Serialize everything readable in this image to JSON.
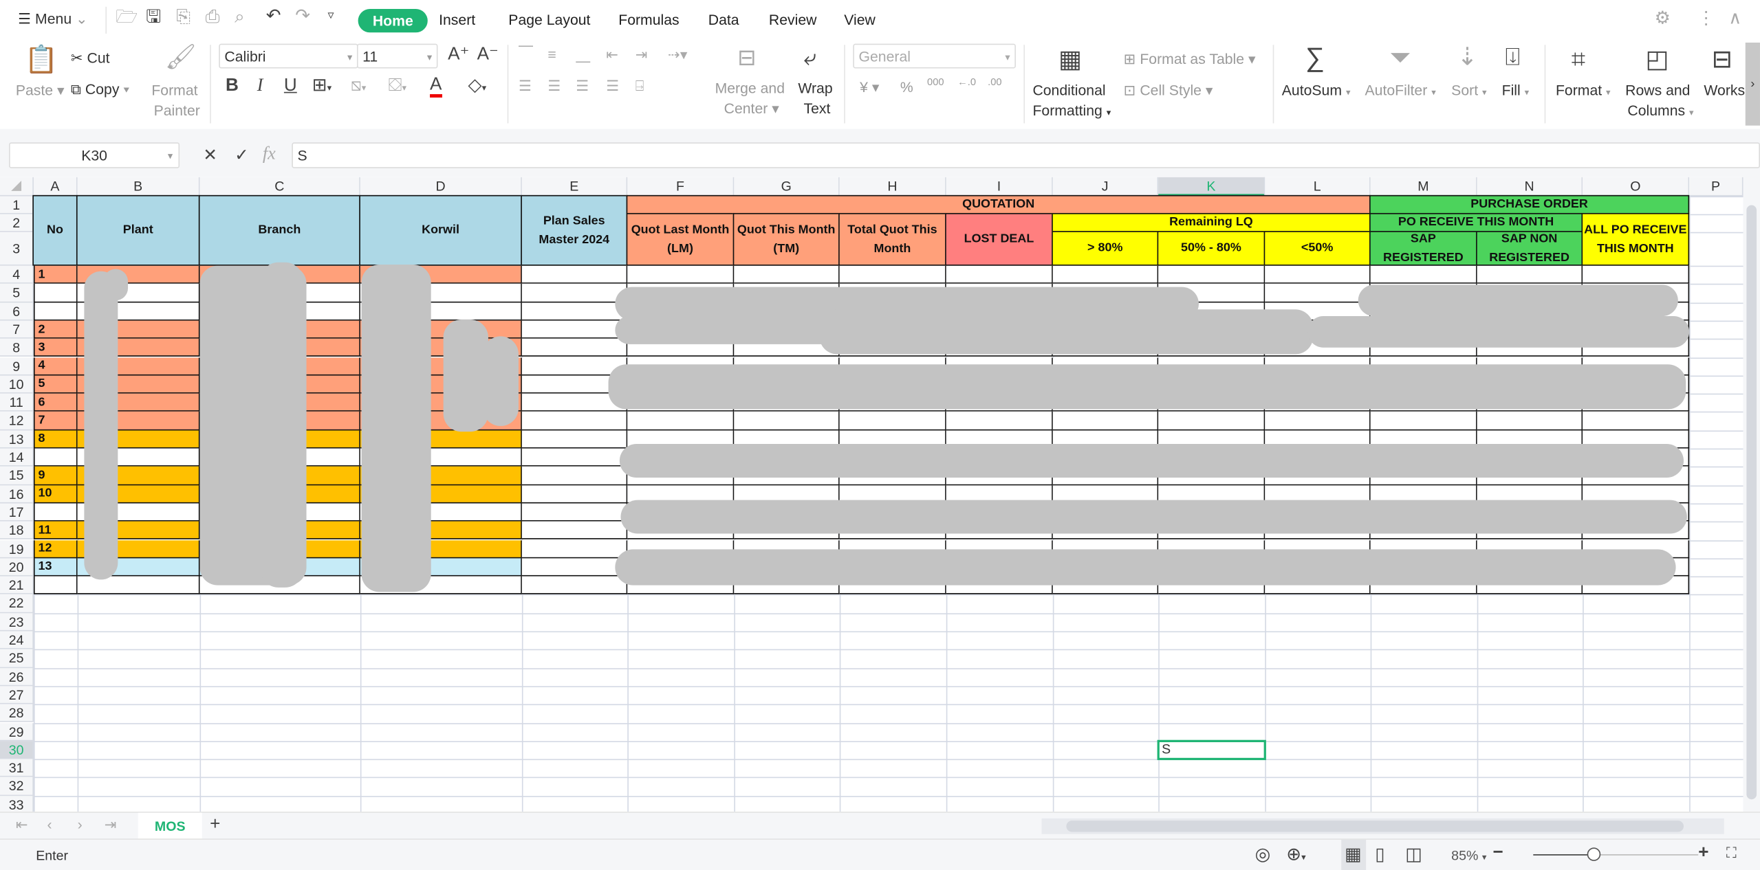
{
  "topbar": {
    "menu_label": "Menu",
    "tabs": [
      "Home",
      "Insert",
      "Page Layout",
      "Formulas",
      "Data",
      "Review",
      "View"
    ],
    "active_tab": "Home"
  },
  "ribbon": {
    "paste": "Paste",
    "cut": "Cut",
    "copy": "Copy",
    "format_painter": [
      "Format",
      "Painter"
    ],
    "font_name": "Calibri",
    "font_size": "11",
    "merge_center": [
      "Merge and",
      "Center"
    ],
    "wrap_text": [
      "Wrap",
      "Text"
    ],
    "number_format": "General",
    "conditional_formatting": [
      "Conditional",
      "Formatting"
    ],
    "format_as_table": "Format as Table",
    "cell_style": "Cell Style",
    "autosum": "AutoSum",
    "autofilter": "AutoFilter",
    "sort": "Sort",
    "fill": "Fill",
    "format": "Format",
    "rows_columns": [
      "Rows and",
      "Columns"
    ],
    "worksheet": "Works",
    "number_buttons": [
      "¥",
      "%",
      "000",
      "←.0",
      ".00"
    ]
  },
  "formula_bar": {
    "name_box": "K30",
    "fx": "fx",
    "value": "S"
  },
  "grid": {
    "columns": [
      "A",
      "B",
      "C",
      "D",
      "E",
      "F",
      "G",
      "H",
      "I",
      "J",
      "K",
      "L",
      "M",
      "N",
      "O",
      "P"
    ],
    "rows": [
      1,
      2,
      3,
      4,
      5,
      6,
      7,
      8,
      9,
      10,
      11,
      12,
      13,
      14,
      15,
      16,
      17,
      18,
      19,
      20,
      21,
      22,
      23,
      24,
      25,
      26,
      27,
      28,
      29,
      30,
      31,
      32,
      33
    ],
    "active_cell": "K30",
    "active_cell_value": "S",
    "headers": [
      {
        "range": "A1:A3",
        "text": "No",
        "fill": "#ADD8E6"
      },
      {
        "range": "B1:B3",
        "text": "Plant",
        "fill": "#ADD8E6"
      },
      {
        "range": "C1:C3",
        "text": "Branch",
        "fill": "#ADD8E6"
      },
      {
        "range": "D1:D3",
        "text": "Korwil",
        "fill": "#ADD8E6"
      },
      {
        "range": "E1:E3",
        "text": "Plan Sales Master 2024",
        "fill": "#ADD8E6"
      },
      {
        "range": "F1:L1",
        "text": "QUOTATION",
        "fill": "#FFA07A"
      },
      {
        "range": "F2:F3",
        "text": "Quot Last Month (LM)",
        "fill": "#FFA07A"
      },
      {
        "range": "G2:G3",
        "text": "Quot This Month (TM)",
        "fill": "#FFA07A"
      },
      {
        "range": "H2:H3",
        "text": "Total Quot This Month",
        "fill": "#FFA07A"
      },
      {
        "range": "I2:I3",
        "text": "LOST DEAL",
        "fill": "#FF7F7F"
      },
      {
        "range": "J2:L2",
        "text": "Remaining LQ",
        "fill": "#FFFF00"
      },
      {
        "range": "J3:J3",
        "text": "> 80%",
        "fill": "#FFFF00"
      },
      {
        "range": "K3:K3",
        "text": "50% - 80%",
        "fill": "#FFFF00"
      },
      {
        "range": "L3:L3",
        "text": "<50%",
        "fill": "#FFFF00"
      },
      {
        "range": "M1:O1",
        "text": "PURCHASE ORDER",
        "fill": "#4CD35C"
      },
      {
        "range": "M2:N2",
        "text": "PO RECEIVE THIS MONTH",
        "fill": "#4CD35C"
      },
      {
        "range": "M3:M3",
        "text": "SAP REGISTERED",
        "fill": "#4CD35C"
      },
      {
        "range": "N3:N3",
        "text": "SAP NON REGISTERED",
        "fill": "#4CD35C"
      },
      {
        "range": "O2:O3",
        "text": "ALL PO RECEIVE THIS MONTH",
        "fill": "#FFFF00"
      }
    ],
    "data_rows": [
      {
        "row": 4,
        "no": "1",
        "fill": "#FFA07A"
      },
      {
        "row": 5,
        "no": "",
        "fill": "#FFFFFF"
      },
      {
        "row": 6,
        "no": "",
        "fill": "#FFFFFF"
      },
      {
        "row": 7,
        "no": "2",
        "fill": "#FFA07A"
      },
      {
        "row": 8,
        "no": "3",
        "fill": "#FFA07A"
      },
      {
        "row": 9,
        "no": "4",
        "fill": "#FFA07A"
      },
      {
        "row": 10,
        "no": "5",
        "fill": "#FFA07A"
      },
      {
        "row": 11,
        "no": "6",
        "fill": "#FFA07A"
      },
      {
        "row": 12,
        "no": "7",
        "fill": "#FFA07A"
      },
      {
        "row": 13,
        "no": "8",
        "fill": "#FFC000"
      },
      {
        "row": 14,
        "no": "",
        "fill": "#FFFFFF"
      },
      {
        "row": 15,
        "no": "9",
        "fill": "#FFC000"
      },
      {
        "row": 16,
        "no": "10",
        "fill": "#FFC000"
      },
      {
        "row": 17,
        "no": "",
        "fill": "#FFFFFF"
      },
      {
        "row": 18,
        "no": "11",
        "fill": "#FFC000"
      },
      {
        "row": 19,
        "no": "12",
        "fill": "#FFC000"
      },
      {
        "row": 20,
        "no": "13",
        "fill": "#C6EBF7"
      },
      {
        "row": 21,
        "no": "",
        "fill": "#FFFFFF"
      }
    ]
  },
  "sheets": {
    "tabs": [
      "MOS"
    ],
    "active": "MOS"
  },
  "status": {
    "mode": "Enter",
    "zoom": "85%",
    "zoom_slider_fraction": 0.37
  },
  "colors": {
    "accent": "#1FB574",
    "redaction": "#C3C3C3"
  }
}
